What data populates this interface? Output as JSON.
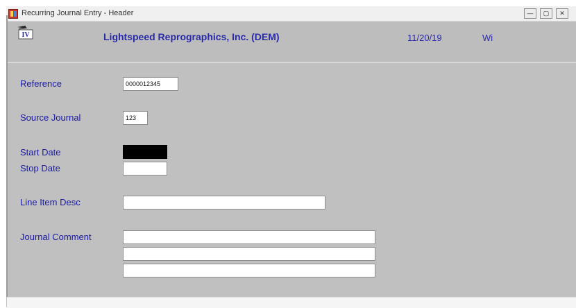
{
  "window": {
    "title": "Recurring Journal Entry - Header",
    "controls": {
      "minimize": "—",
      "maximize": "▢",
      "close": "✕"
    }
  },
  "header": {
    "logo_text": "IV",
    "company": "Lightspeed Reprographics, Inc. (DEM)",
    "date": "11/20/19",
    "user": "Wi"
  },
  "form": {
    "reference": {
      "label": "Reference",
      "value": "0000012345"
    },
    "source_journal": {
      "label": "Source Journal",
      "value": "123"
    },
    "start_date": {
      "label": "Start Date",
      "value": ""
    },
    "stop_date": {
      "label": "Stop Date",
      "value": ""
    },
    "line_item_desc": {
      "label": "Line Item Desc",
      "value": ""
    },
    "journal_comment": {
      "label": "Journal Comment",
      "lines": [
        "",
        "",
        ""
      ]
    }
  },
  "icons": {
    "app": "recurring-journal-app-icon",
    "logo": "software-logo-icon"
  },
  "colors": {
    "label_text": "#1a1aa0",
    "company_text": "#2a2aa8",
    "background": "#c0c0c0",
    "selected_field": "#000000"
  }
}
